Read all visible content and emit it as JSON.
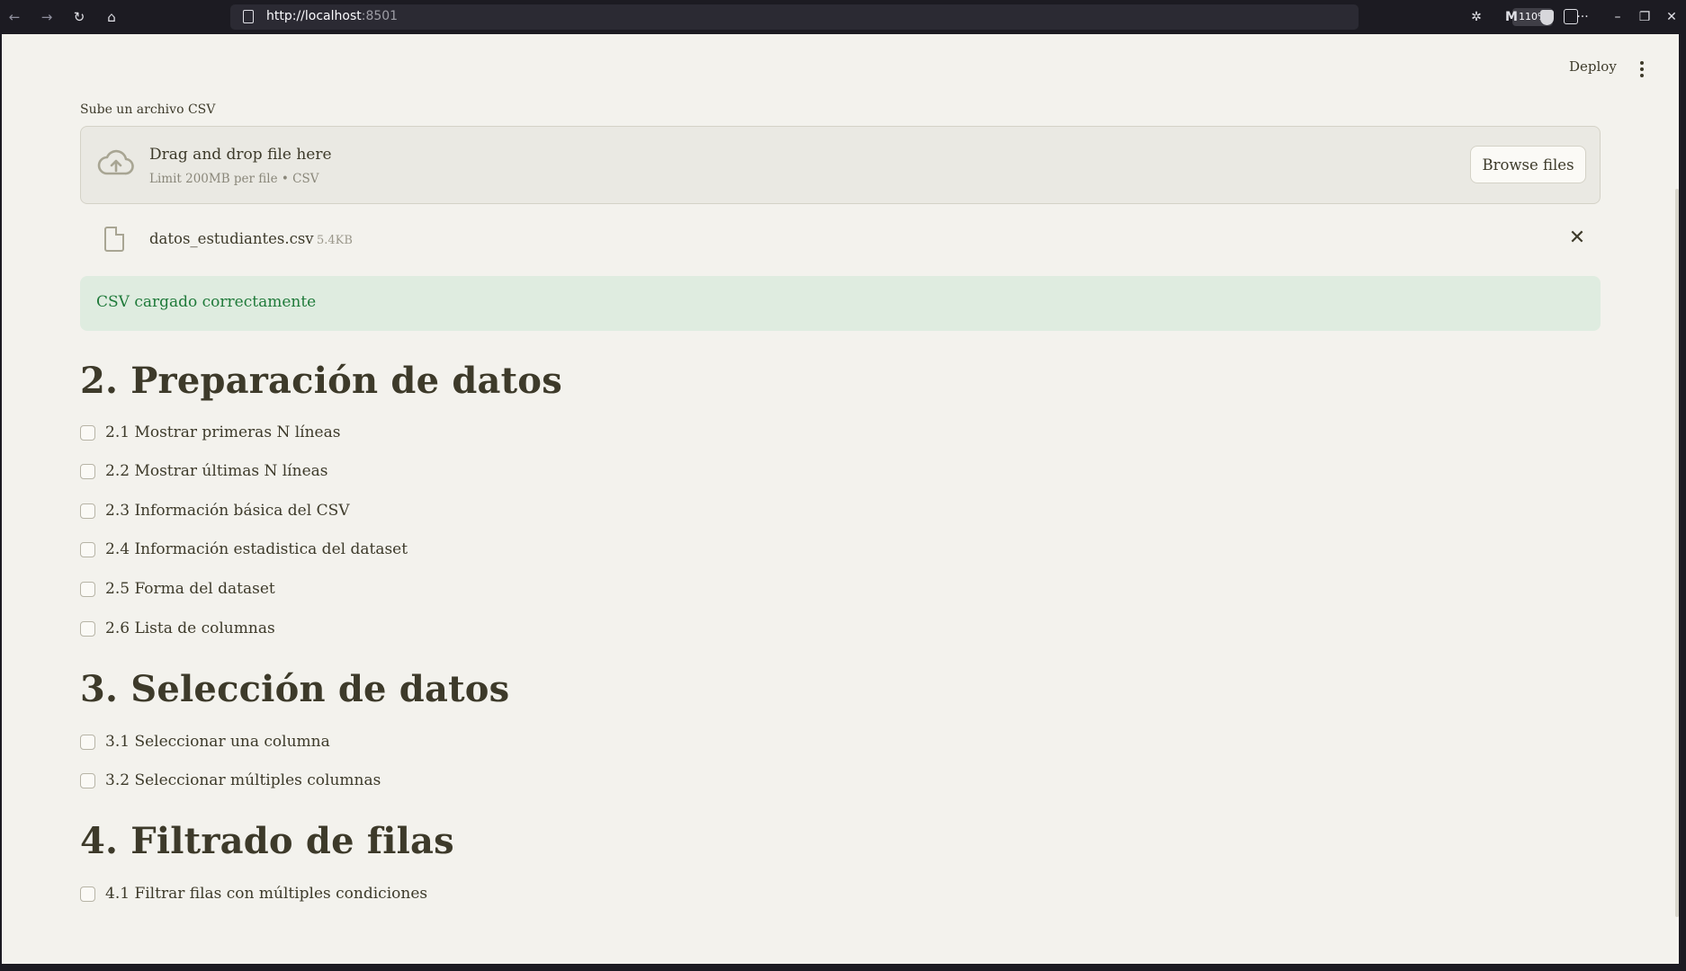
{
  "browser": {
    "url_host": "http://localhost",
    "url_port": ":8501",
    "zoom": "110%"
  },
  "app": {
    "deploy_label": "Deploy"
  },
  "uploader": {
    "label": "Sube un archivo CSV",
    "drop_title": "Drag and drop file here",
    "drop_sub": "Limit 200MB per file • CSV",
    "browse_label": "Browse files"
  },
  "file": {
    "name": "datos_estudiantes.csv",
    "size": "5.4KB"
  },
  "alert": {
    "text": "CSV cargado correctamente"
  },
  "sections": [
    {
      "title": "2. Preparación de datos",
      "items": [
        "2.1 Mostrar primeras N líneas",
        "2.2 Mostrar últimas N líneas",
        "2.3 Información básica del CSV",
        "2.4 Información estadistica del dataset",
        "2.5 Forma del dataset",
        "2.6 Lista de columnas"
      ]
    },
    {
      "title": "3. Selección de datos",
      "items": [
        "3.1 Seleccionar una columna",
        "3.2 Seleccionar múltiples columnas"
      ]
    },
    {
      "title": "4. Filtrado de filas",
      "items": [
        "4.1 Filtrar filas con múltiples condiciones"
      ]
    }
  ],
  "icons": [
    "back-icon",
    "forward-icon",
    "reload-icon",
    "home-icon",
    "page-icon",
    "reader-icon",
    "extension-icon",
    "m-icon",
    "shield-icon",
    "more-icon",
    "cloud-upload-icon",
    "file-icon",
    "close-icon"
  ]
}
